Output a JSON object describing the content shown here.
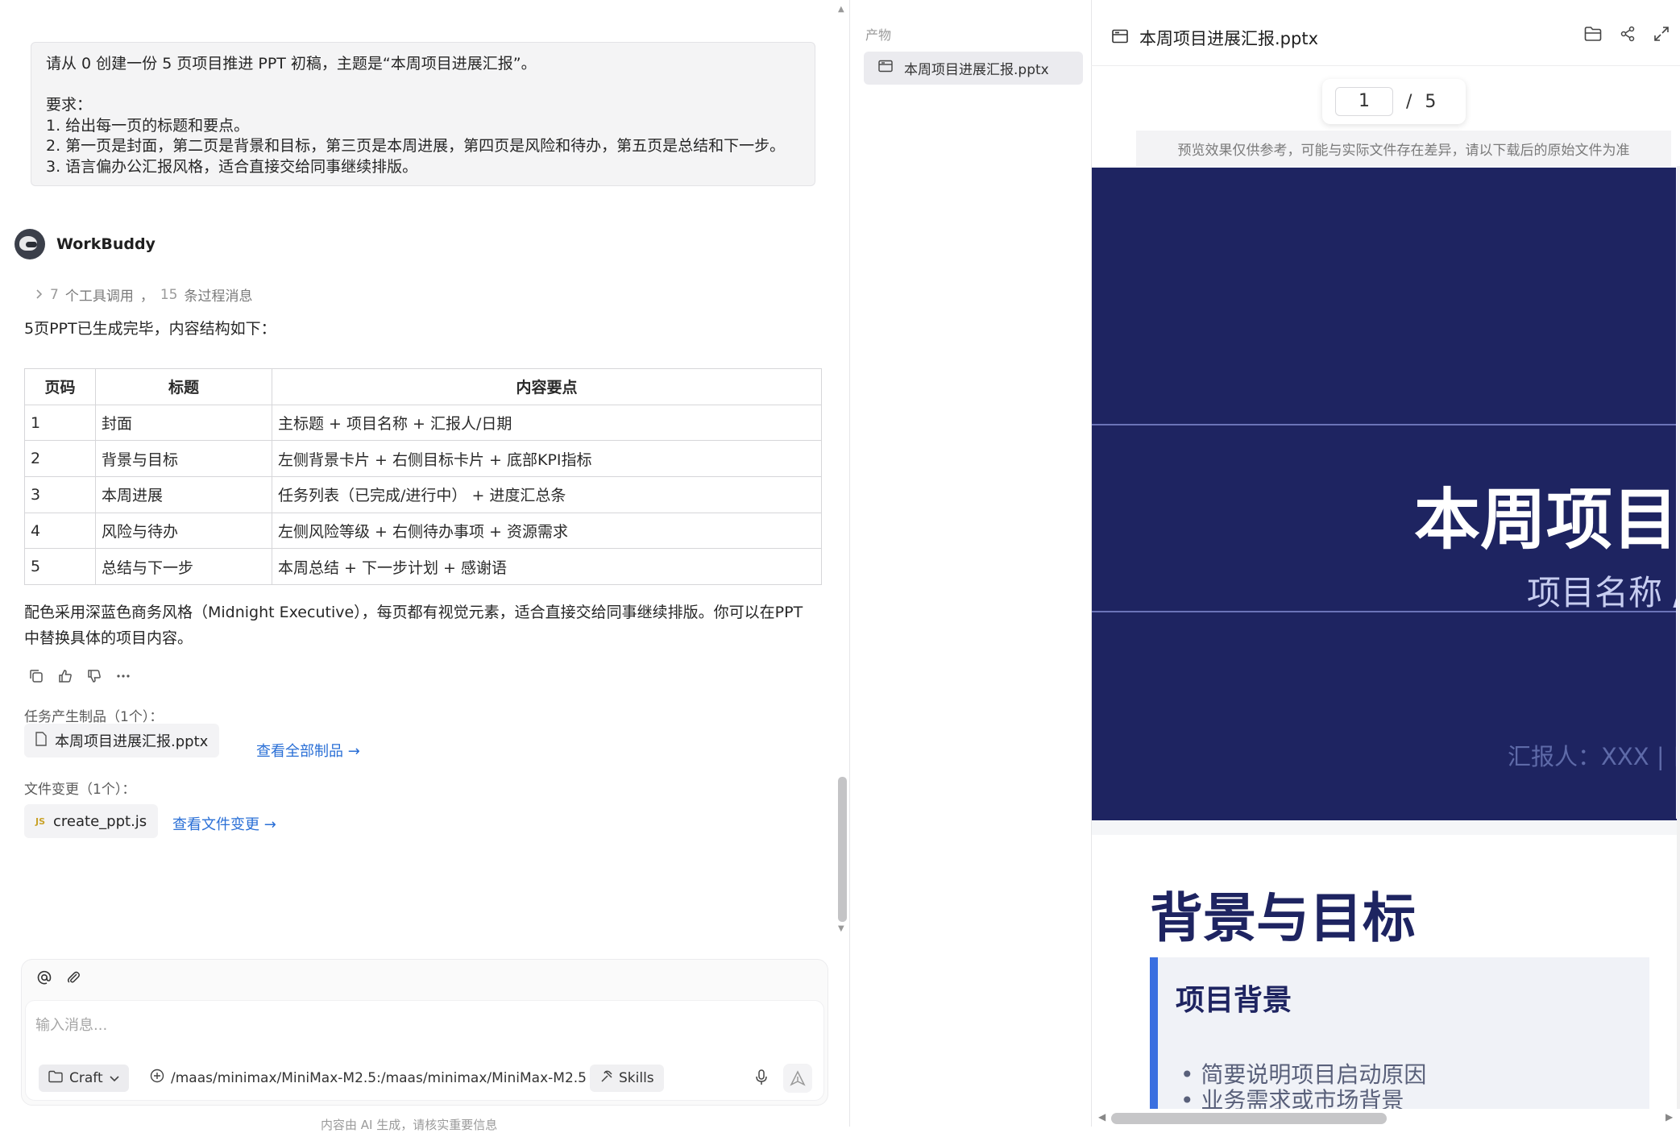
{
  "user_message": {
    "lines": [
      "请从 0 创建一份 5 页项目推进 PPT 初稿，主题是“本周项目进展汇报”。",
      "",
      "要求：",
      "1. 给出每一页的标题和要点。",
      "2. 第一页是封面，第二页是背景和目标，第三页是本周进展，第四页是风险和待办，第五页是总结和下一步。",
      "3. 语言偏办公汇报风格，适合直接交给同事继续排版。"
    ]
  },
  "bot": {
    "name": "WorkBuddy",
    "process": {
      "tool_count": "7",
      "tool_label": "个工具调用",
      "sep": "，",
      "msg_count": "15",
      "msg_label": "条过程消息"
    },
    "intro": "5页PPT已生成完毕，内容结构如下：",
    "table": {
      "headers": [
        "页码",
        "标题",
        "内容要点"
      ],
      "rows": [
        [
          "1",
          "封面",
          "主标题 + 项目名称 + 汇报人/日期"
        ],
        [
          "2",
          "背景与目标",
          "左侧背景卡片 + 右侧目标卡片 + 底部KPI指标"
        ],
        [
          "3",
          "本周进展",
          "任务列表（已完成/进行中） + 进度汇总条"
        ],
        [
          "4",
          "风险与待办",
          "左侧风险等级 + 右侧待办事项 + 资源需求"
        ],
        [
          "5",
          "总结与下一步",
          "本周总结 + 下一步计划 + 感谢语"
        ]
      ]
    },
    "summary_line1": "配色采用深蓝色商务风格（Midnight Executive），每页都有视觉元素，适合直接交给同事继续排版。你可以在PPT",
    "summary_line2": "中替换具体的项目内容。",
    "artifacts_label": "任务产生制品（1个）：",
    "artifact_file": "本周项目进展汇报.pptx",
    "artifacts_link": "查看全部制品 →",
    "changes_label": "文件变更（1个）：",
    "change_file_badge": "JS",
    "change_file": "create_ppt.js",
    "changes_link": "查看文件变更 →"
  },
  "composer": {
    "placeholder": "输入消息...",
    "mode": "Craft",
    "model": "/maas/minimax/MiniMax-M2.5:/maas/minimax/MiniMax-M2.5",
    "skills": "Skills",
    "disclaimer": "内容由 AI 生成，请核实重要信息"
  },
  "artifacts_panel": {
    "label": "产物",
    "item": "本周项目进展汇报.pptx"
  },
  "preview": {
    "title": "本周项目进展汇报.pptx",
    "page_current": "1",
    "page_sep": "/",
    "page_total": "5",
    "note": "预览效果仅供参考，可能与实际文件存在差异，请以下载后的原始文件为准",
    "slide1": {
      "title": "本周项目进展汇报",
      "subtitle": "项目名称 / 项目编号",
      "reporter": "汇报人：XXX | 日期：XXXX"
    },
    "slide2": {
      "title": "背景与目标",
      "card_title": "项目背景",
      "bullet1": "• 简要说明项目启动原因",
      "bullet2": "• 业务需求或市场背景"
    }
  },
  "colors": {
    "slide_bg": "#1e2461",
    "accent_blue": "#3a6fe0",
    "link": "#2a6fd6"
  }
}
